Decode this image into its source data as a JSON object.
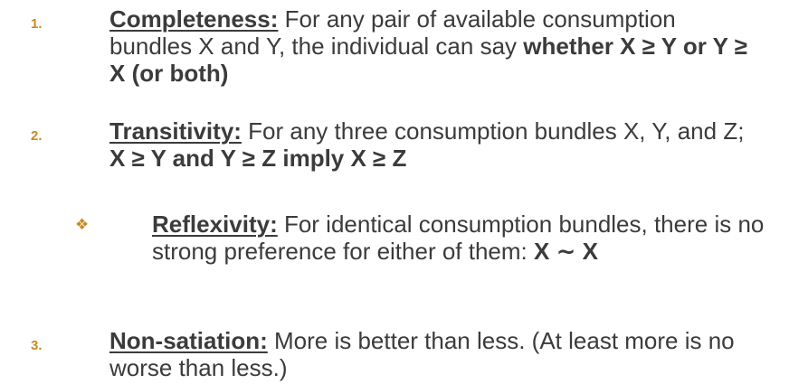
{
  "items": [
    {
      "marker": "1.",
      "term": "Completeness:",
      "parts": [
        " For any pair of available consumption bundles X and Y, the individual can say ",
        "whether X ≥ Y or Y ≥ X (or both)"
      ]
    },
    {
      "marker": "2.",
      "term": "Transitivity:",
      "parts": [
        " For any three consumption bundles X, Y, and Z; ",
        "X ≥ Y and Y ≥ Z imply X ≥ Z"
      ]
    },
    {
      "marker": "❖",
      "term": "Reflexivity:",
      "parts": [
        " For identical consumption bundles, there is no strong preference for either of them: ",
        "X ∼ X"
      ]
    },
    {
      "marker": "3.",
      "term": "Non-satiation:",
      "parts": [
        " More is better than less. (At least more is no worse than less.)"
      ]
    }
  ],
  "colors": {
    "marker": "#c98a1e",
    "text": "#3b3b3b"
  }
}
